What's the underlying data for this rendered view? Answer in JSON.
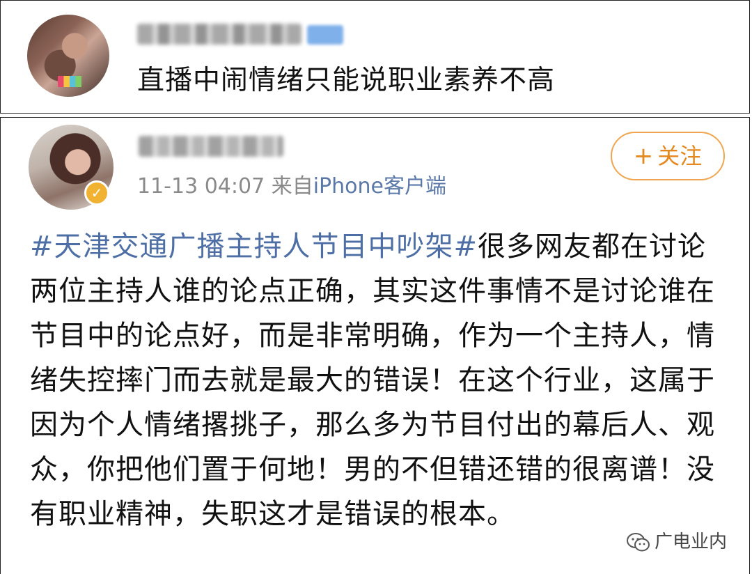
{
  "comment": {
    "avatar_icon": "user-avatar-icon",
    "text": "直播中闹情绪只能说职业素养不高"
  },
  "post": {
    "avatar_icon": "user-avatar-icon",
    "verified_icon": "verified-badge-icon",
    "verified_glyph": "✓",
    "timestamp": "11-13 04:07",
    "source_prefix": "来自",
    "source": "iPhone客户端",
    "follow_label": "关注",
    "follow_glyph": "+",
    "hashtag": "#天津交通广播主持人节目中吵架#",
    "body": "很多网友都在讨论两位主持人谁的论点正确，其实这件事情不是讨论谁在节目中的论点好，而是非常明确，作为一个主持人，情绪失控摔门而去就是最大的错误！在这个行业，这属于因为个人情绪撂挑子，那么多为节目付出的幕后人、观众，你把他们置于何地！男的不但错还错的很离谱！没有职业精神，失职这才是错误的根本。"
  },
  "watermark": {
    "icon": "wechat-icon",
    "text": "广电业内"
  },
  "colors": {
    "hashtag": "#4e6fa6",
    "follow": "#e3891f",
    "meta": "#8a8a8a",
    "verified": "#f2b231"
  }
}
